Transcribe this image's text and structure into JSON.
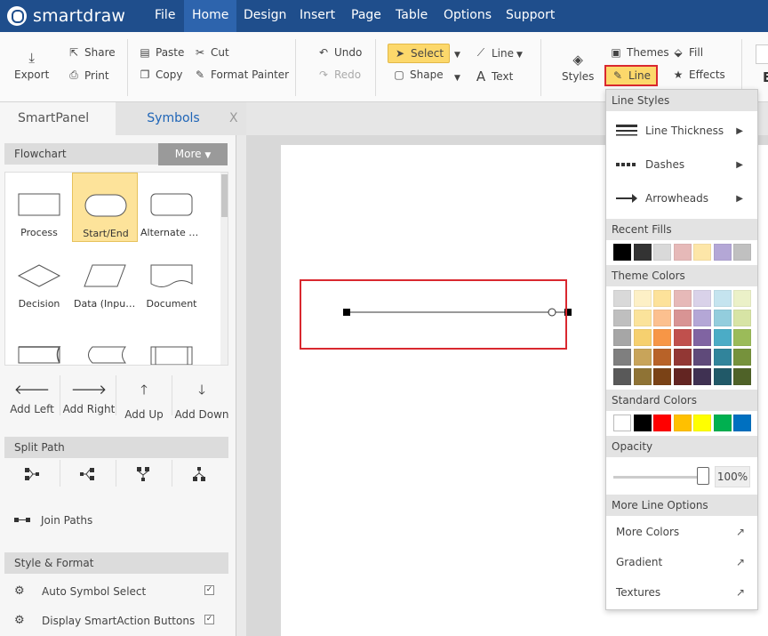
{
  "app": {
    "name": "smartdraw"
  },
  "menu": [
    "File",
    "Home",
    "Design",
    "Insert",
    "Page",
    "Table",
    "Options",
    "Support"
  ],
  "ribbon": {
    "export": "Export",
    "share": "Share",
    "print": "Print",
    "paste": "Paste",
    "copy": "Copy",
    "cut": "Cut",
    "format_painter": "Format Painter",
    "undo": "Undo",
    "redo": "Redo",
    "select": "Select",
    "shape": "Shape",
    "line": "Line",
    "text": "Text",
    "styles": "Styles",
    "themes": "Themes",
    "line_style": "Line",
    "fill": "Fill",
    "effects": "Effects",
    "cut_off": "E"
  },
  "panel": {
    "tab_smart": "SmartPanel",
    "tab_symbols": "Symbols",
    "close": "X",
    "flowchart": "Flowchart",
    "more": "More",
    "shapes": [
      "Process",
      "Start/End",
      "Alternate Pr...",
      "Decision",
      "Data (Input...",
      "Document",
      "",
      "",
      ""
    ],
    "add": [
      "Add Left",
      "Add Right",
      "Add Up",
      "Add Down"
    ],
    "split_path": "Split Path",
    "join_paths": "Join Paths",
    "style_format": "Style & Format",
    "auto_symbol": "Auto Symbol Select",
    "display_smartaction": "Display SmartAction Buttons"
  },
  "dropdown": {
    "line_styles": "Line Styles",
    "line_thickness": "Line Thickness",
    "dashes": "Dashes",
    "arrowheads": "Arrowheads",
    "recent_fills": "Recent Fills",
    "theme_colors": "Theme Colors",
    "standard_colors": "Standard Colors",
    "opacity": "Opacity",
    "opacity_value": "100%",
    "opacity_level": 1.0,
    "more_line_options": "More Line Options",
    "more_colors": "More Colors",
    "gradient": "Gradient",
    "textures": "Textures"
  },
  "colors": {
    "recent_fills": [
      "#000000",
      "#333333",
      "#d9d9d9",
      "#e6b9b8",
      "#fde6a8",
      "#b4a7d6",
      "#c0c0c0"
    ],
    "theme_colors": [
      [
        "#d9d9d9",
        "#fdf0c6",
        "#fde29a",
        "#e6b9b8",
        "#d9d2e9",
        "#c5e4ef",
        "#ebf1c8"
      ],
      [
        "#bfbfbf",
        "#fbe39b",
        "#fcc08f",
        "#d89494",
        "#b4a7d6",
        "#93cddd",
        "#d7e4a5"
      ],
      [
        "#a6a6a6",
        "#f6d06f",
        "#f79646",
        "#c0504d",
        "#8064a2",
        "#4bacc6",
        "#9bbb59"
      ],
      [
        "#7f7f7f",
        "#c8a45a",
        "#b86228",
        "#923734",
        "#5f4a7a",
        "#31849b",
        "#76923c"
      ],
      [
        "#595959",
        "#8f7335",
        "#7a4216",
        "#632522",
        "#3f3152",
        "#215968",
        "#4f6228"
      ]
    ],
    "standard": [
      "#ffffff",
      "#000000",
      "#ff0000",
      "#ffc000",
      "#ffff00",
      "#00b050",
      "#0070c0"
    ],
    "brand_blue": "#1f4e8c",
    "highlight_yellow": "#fcd86b",
    "annotation_red": "#d9282f"
  }
}
